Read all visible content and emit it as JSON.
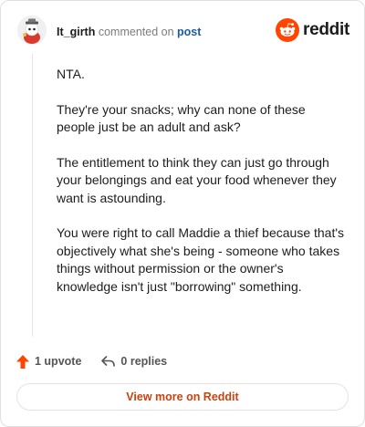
{
  "comment": {
    "username": "It_girth",
    "action_text": "commented on",
    "post_link": "post",
    "paragraphs": [
      "NTA.",
      "They're your snacks; why can none of these people just be an adult and ask?",
      "The entitlement to think they can just go through your belongings and eat your food whenever they want is astounding.",
      "You were right to call Maddie a thief because that's objectively what she's being - someone who takes things without permission or the owner's knowledge isn't just \"borrowing\" something."
    ]
  },
  "brand": {
    "name": "reddit",
    "color": "#ff4500"
  },
  "footer": {
    "upvote_label": "1 upvote",
    "replies_label": "0 replies",
    "upvote_color": "#ff4500"
  },
  "view_more_label": "View more on Reddit",
  "icons": [
    "avatar-icon",
    "reddit-logo-icon",
    "upvote-arrow-icon",
    "reply-arrow-icon"
  ]
}
